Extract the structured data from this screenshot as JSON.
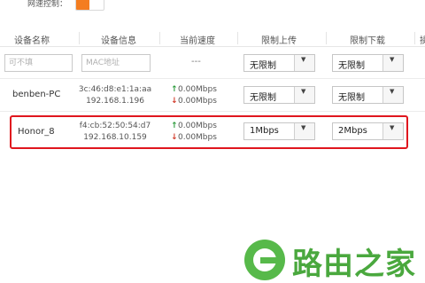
{
  "speed_control": {
    "label": "网速控制：",
    "enabled": true
  },
  "headers": {
    "device_name": "设备名称",
    "device_info": "设备信息",
    "current_speed": "当前速度",
    "upload_limit": "限制上传",
    "download_limit": "限制下载",
    "action": "操"
  },
  "add_row": {
    "name_placeholder": "可不填",
    "mac_placeholder": "MAC地址",
    "speed_text": "---",
    "upload_limit": "无限制",
    "download_limit": "无限制"
  },
  "devices": [
    {
      "name": "benben-PC",
      "mac": "3c:46:d8:e1:1a:aa",
      "ip": "192.168.1.196",
      "up_speed": "0.00Mbps",
      "down_speed": "0.00Mbps",
      "upload_limit": "无限制",
      "download_limit": "无限制"
    },
    {
      "name": "Honor_8",
      "mac": "f4:cb:52:50:54:d7",
      "ip": "192.168.10.159",
      "up_speed": "0.00Mbps",
      "down_speed": "0.00Mbps",
      "upload_limit": "1Mbps",
      "download_limit": "2Mbps"
    }
  ],
  "watermark": {
    "text": "路由之家"
  },
  "colors": {
    "toggle_on": "#f47d20",
    "highlight": "#e0161e",
    "arrow_up": "#2a9a3a",
    "arrow_down": "#d23a2a",
    "watermark": "#4aa83e"
  }
}
